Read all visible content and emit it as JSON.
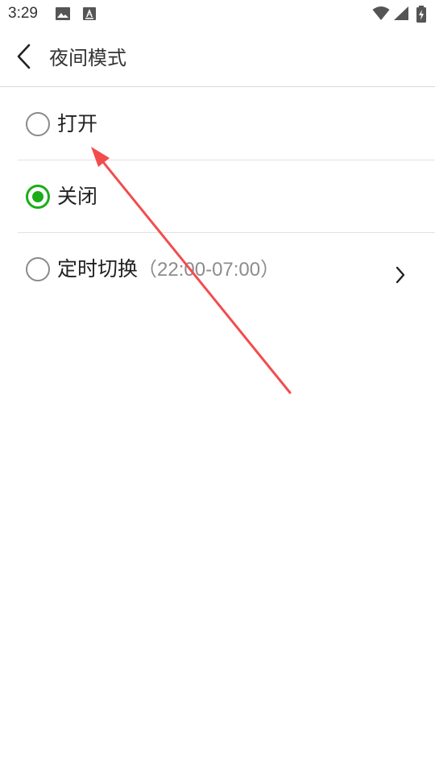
{
  "status_bar": {
    "time": "3:29",
    "icons": [
      "image-icon",
      "font-app-icon",
      "wifi-icon",
      "signal-icon",
      "battery-charging-icon"
    ]
  },
  "header": {
    "back_icon": "chevron-left-icon",
    "title": "夜间模式"
  },
  "options": [
    {
      "label": "打开",
      "checked": false
    },
    {
      "label": "关闭",
      "checked": true
    },
    {
      "label": "定时切换",
      "sub": "（22:00-07:00）",
      "checked": false,
      "has_chevron": true
    }
  ],
  "colors": {
    "accent": "#1aad19",
    "annotation": "#f24d4d"
  }
}
